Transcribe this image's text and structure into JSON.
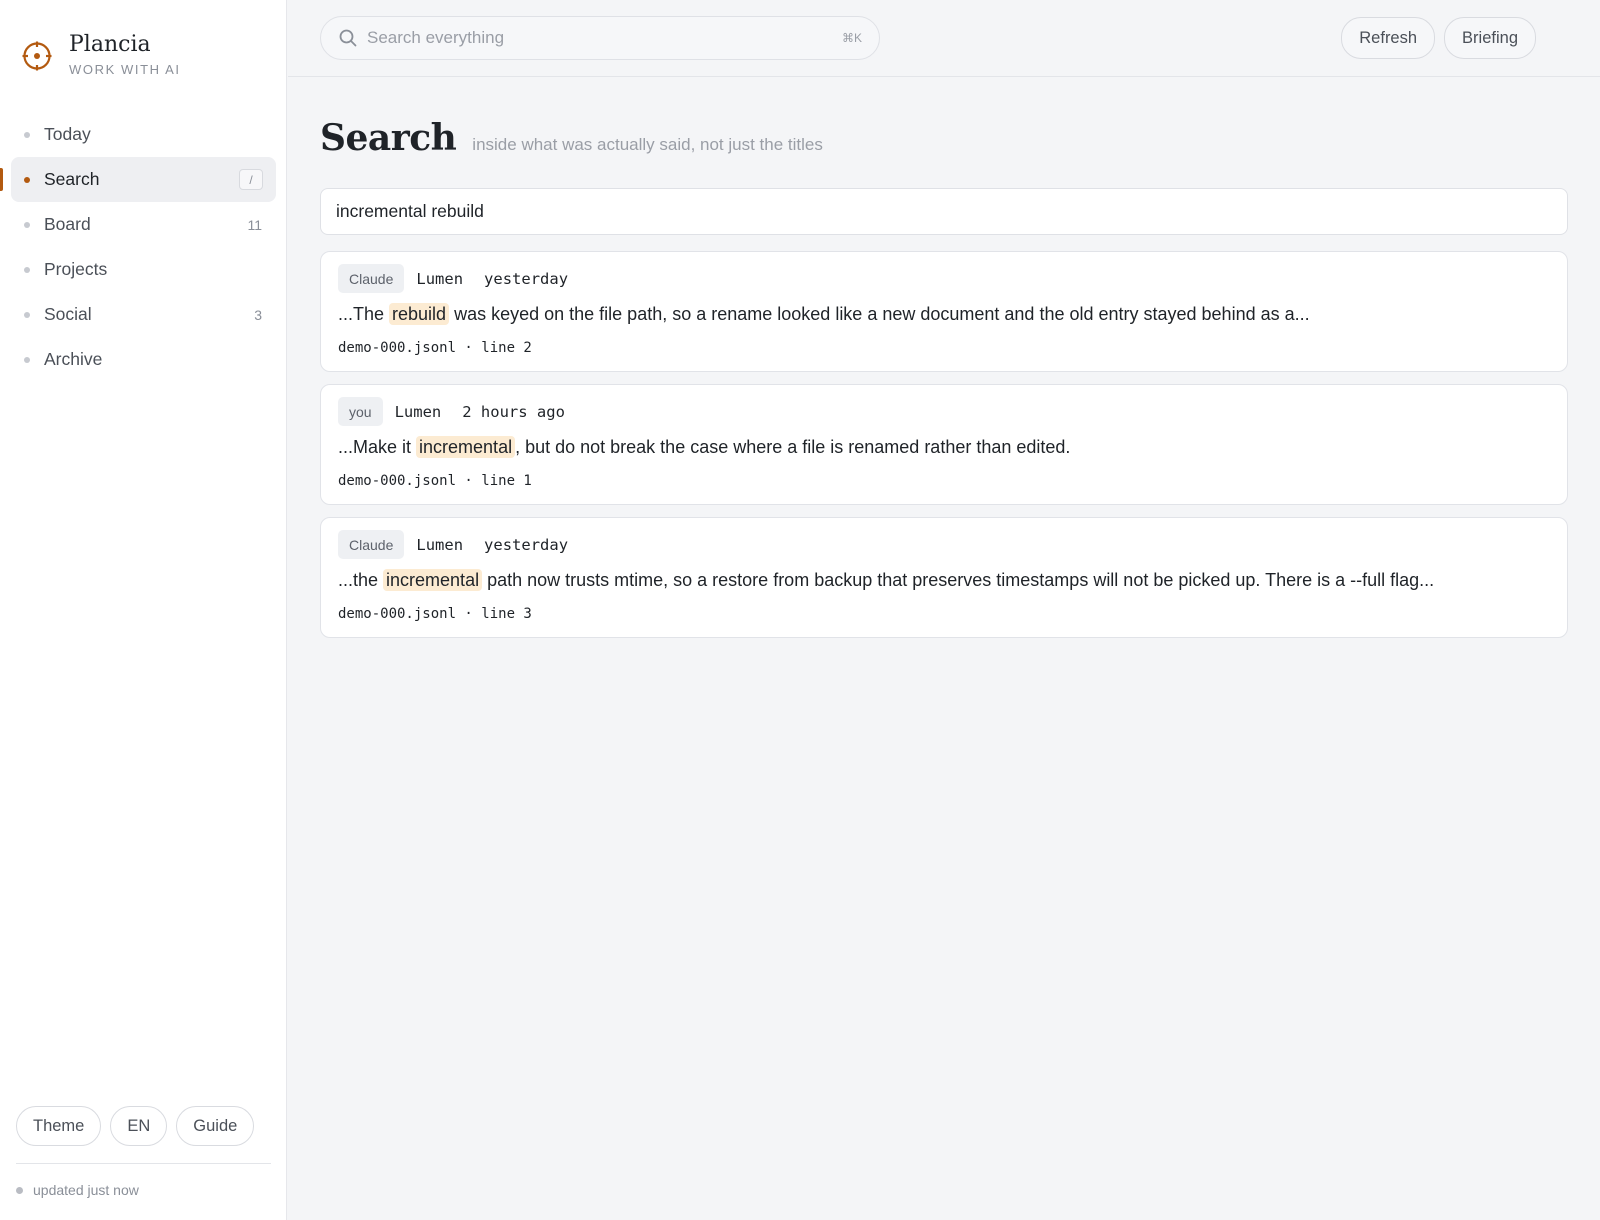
{
  "brand": {
    "name": "Plancia",
    "tagline": "WORK WITH AI",
    "accent": "#b35a10"
  },
  "nav": [
    {
      "label": "Today",
      "count": "",
      "shortcut": "",
      "active": false
    },
    {
      "label": "Search",
      "count": "",
      "shortcut": "/",
      "active": true
    },
    {
      "label": "Board",
      "count": "11",
      "shortcut": "",
      "active": false
    },
    {
      "label": "Projects",
      "count": "",
      "shortcut": "",
      "active": false
    },
    {
      "label": "Social",
      "count": "3",
      "shortcut": "",
      "active": false
    },
    {
      "label": "Archive",
      "count": "",
      "shortcut": "",
      "active": false
    }
  ],
  "footer": {
    "theme_label": "Theme",
    "lang_label": "EN",
    "guide_label": "Guide",
    "status_text": "updated just now"
  },
  "topbar": {
    "search_placeholder": "Search everything",
    "search_shortcut": "⌘K",
    "refresh_label": "Refresh",
    "briefing_label": "Briefing"
  },
  "page": {
    "title": "Search",
    "subtitle": "inside what was actually said, not just the titles",
    "query": "incremental rebuild"
  },
  "results": [
    {
      "role": "Claude",
      "project": "Lumen",
      "time": "yesterday",
      "before": "...The ",
      "match": "rebuild",
      "after": " was keyed on the file path, so a rename looked like a new document and the old entry stayed behind as a...",
      "source": "demo-000.jsonl · line 2"
    },
    {
      "role": "you",
      "project": "Lumen",
      "time": "2 hours ago",
      "before": "...Make it ",
      "match": "incremental",
      "after": ", but do not break the case where a file is renamed rather than edited.",
      "source": "demo-000.jsonl · line 1"
    },
    {
      "role": "Claude",
      "project": "Lumen",
      "time": "yesterday",
      "before": "...the ",
      "match": "incremental",
      "after": " path now trusts mtime, so a restore from backup that preserves timestamps will not be picked up. There is a --full flag...",
      "source": "demo-000.jsonl · line 3"
    }
  ],
  "icons": {
    "logo": "crosshair-logo-icon",
    "search": "search-icon"
  }
}
